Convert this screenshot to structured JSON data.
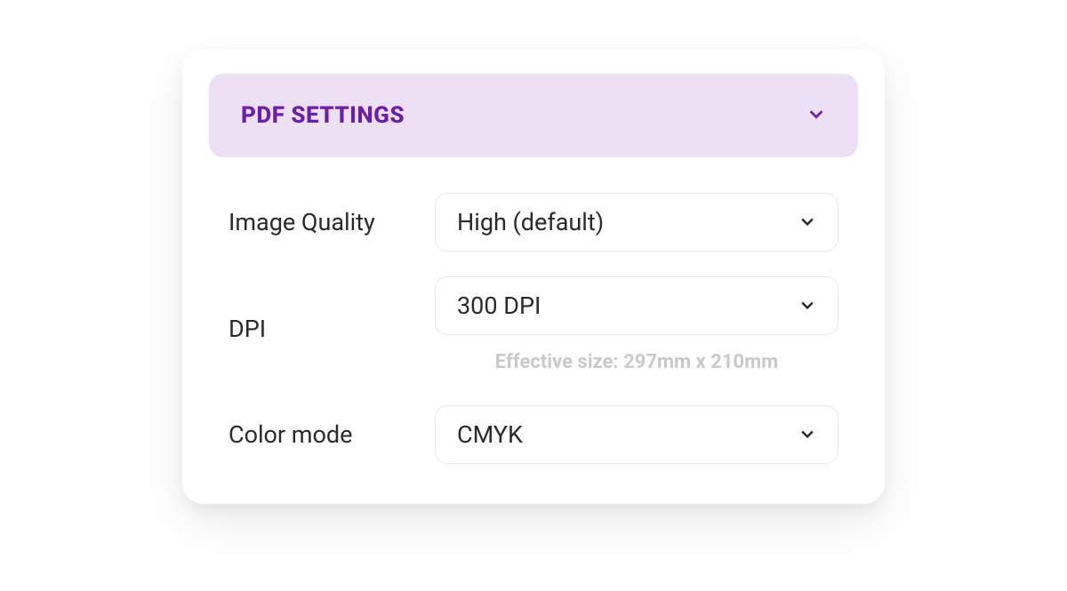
{
  "section": {
    "title": "PDF SETTINGS"
  },
  "fields": {
    "image_quality": {
      "label": "Image Quality",
      "value": "High (default)"
    },
    "dpi": {
      "label": "DPI",
      "value": "300 DPI",
      "helper": "Effective size: 297mm x 210mm"
    },
    "color_mode": {
      "label": "Color mode",
      "value": "CMYK"
    }
  }
}
